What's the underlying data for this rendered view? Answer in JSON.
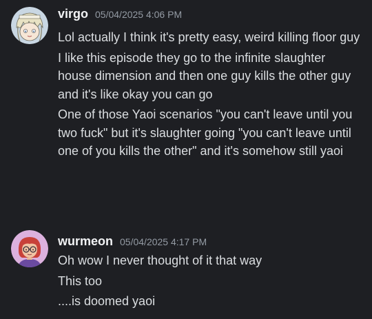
{
  "messages": [
    {
      "author": "virgo",
      "timestamp": "05/04/2025 4:06 PM",
      "avatar_icon": "anime-character-avatar",
      "lines": [
        "Lol actually I think it's pretty easy, weird killing floor guy",
        "I like this episode they go to the infinite slaughter house dimension and then one guy kills the other guy and it's like okay you can go",
        "One of those Yaoi scenarios \"you can't leave until you two fuck\" but it's slaughter going \"you can't leave until one of you kills the other\" and it's somehow still yaoi"
      ]
    },
    {
      "author": "wurmeon",
      "timestamp": "05/04/2025 4:17 PM",
      "avatar_icon": "red-haired-glasses-avatar",
      "lines": [
        "Oh wow I never thought of it that way",
        "This too",
        "....is doomed yaoi"
      ]
    }
  ],
  "colors": {
    "background": "#1e1f23",
    "username": "#f2f3f5",
    "timestamp": "#949ba4",
    "message_text": "#dbdee1"
  }
}
